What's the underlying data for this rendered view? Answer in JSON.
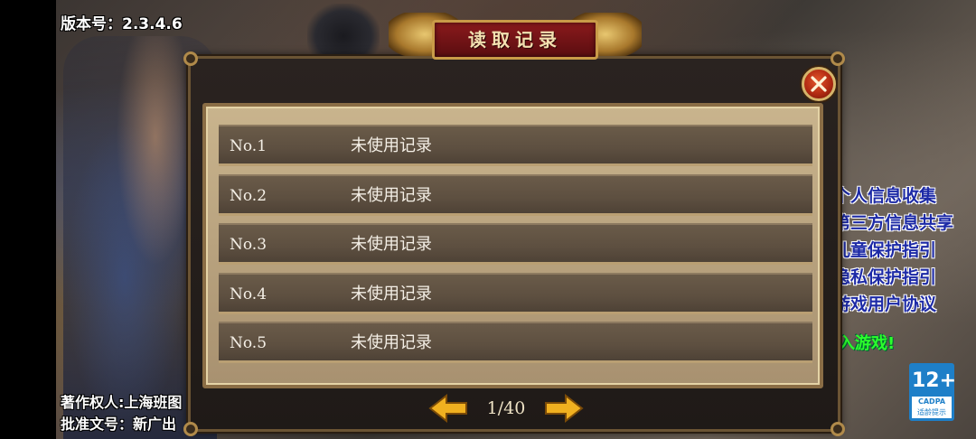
{
  "version_label": "版本号：2.3.4.6",
  "copyright": "著作权人:上海班图",
  "approval": "批准文号：新广出",
  "right_links": [
    "个人信息收集",
    "第三方信息共享",
    "儿童保护指引",
    "隐私保护指引",
    "游戏用户协议"
  ],
  "enter_game": "入游戏!",
  "age_badge": {
    "rating": "12+",
    "org": "CADPA",
    "tip": "适龄提示"
  },
  "dialog": {
    "title": "读取记录",
    "slots": [
      {
        "number": "No.1",
        "status": "未使用记录"
      },
      {
        "number": "No.2",
        "status": "未使用记录"
      },
      {
        "number": "No.3",
        "status": "未使用记录"
      },
      {
        "number": "No.4",
        "status": "未使用记录"
      },
      {
        "number": "No.5",
        "status": "未使用记录"
      }
    ],
    "pagination": "1/40"
  },
  "icons": {
    "close": "close-icon",
    "prev": "arrow-left-icon",
    "next": "arrow-right-icon"
  },
  "colors": {
    "title_red": "#8a1a1c",
    "gold": "#c99b48",
    "link_blue": "#1d2aa6",
    "enter_green": "#2cff2c",
    "badge_blue": "#1e7fc8"
  }
}
